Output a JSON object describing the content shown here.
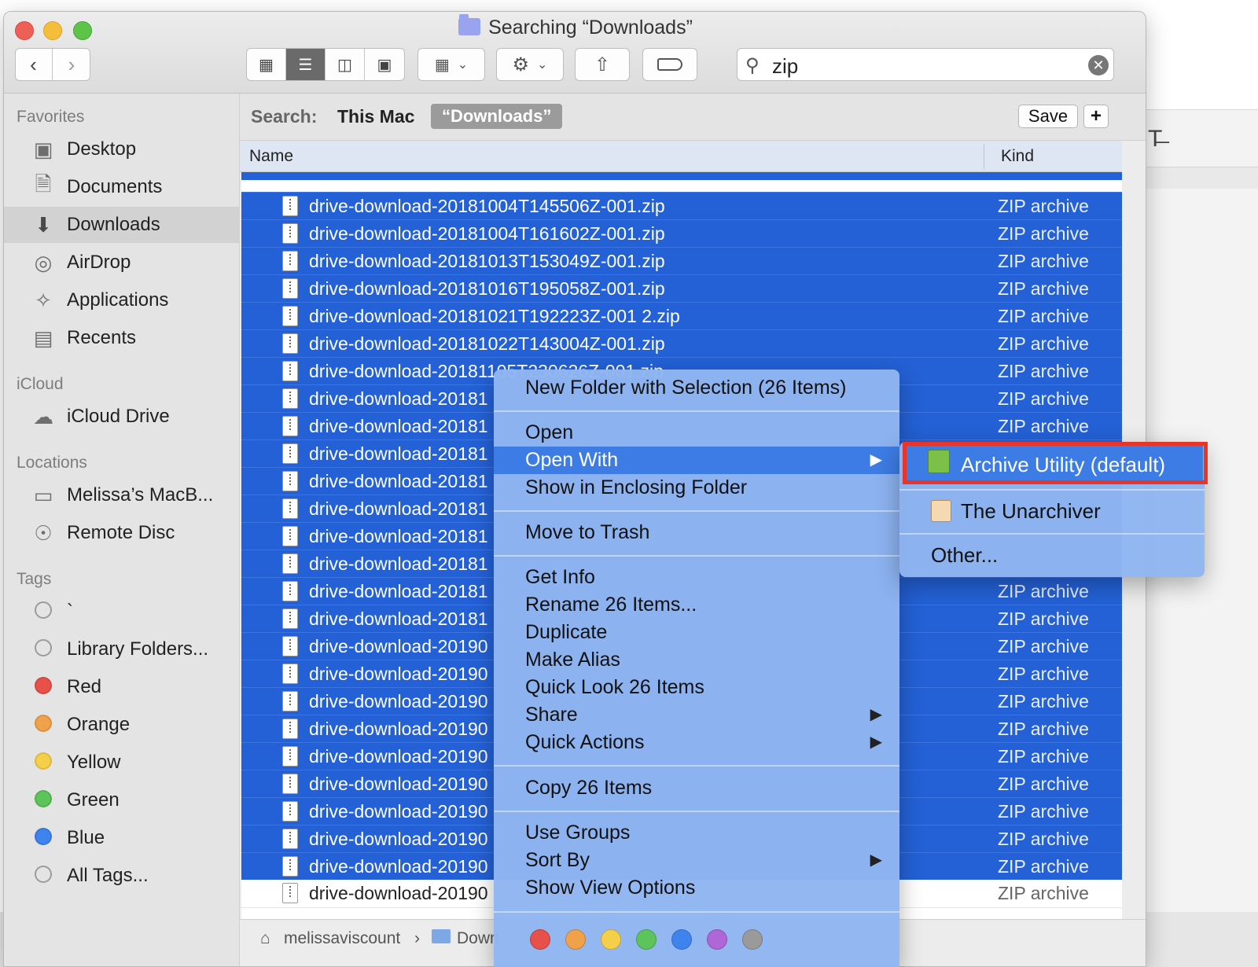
{
  "window": {
    "title": "Searching “Downloads”"
  },
  "toolbar": {
    "search_value": "zip",
    "icons": [
      "icon-view-icon",
      "list-view-icon",
      "column-view-icon",
      "gallery-view-icon",
      "group-icon",
      "gear-icon",
      "share-icon",
      "tag-icon",
      "search-icon",
      "clear-icon"
    ]
  },
  "sidebar": {
    "favorites_label": "Favorites",
    "favorites": [
      "Desktop",
      "Documents",
      "Downloads",
      "AirDrop",
      "Applications",
      "Recents"
    ],
    "icloud_label": "iCloud",
    "icloud": [
      "iCloud Drive"
    ],
    "locations_label": "Locations",
    "locations": [
      "Melissa’s MacB...",
      "Remote Disc"
    ],
    "tags_label": "Tags",
    "tags": [
      {
        "name": "`",
        "color": "#d0d0d0"
      },
      {
        "name": "Library Folders...",
        "color": "#d0d0d0"
      },
      {
        "name": "Red",
        "color": "#e8504a"
      },
      {
        "name": "Orange",
        "color": "#f0a24a"
      },
      {
        "name": "Yellow",
        "color": "#f4cf4a"
      },
      {
        "name": "Green",
        "color": "#5cc45a"
      },
      {
        "name": "Blue",
        "color": "#3f84ee"
      },
      {
        "name": "All Tags...",
        "color": "#d0d0d0"
      }
    ]
  },
  "scope": {
    "label": "Search:",
    "this_mac": "This Mac",
    "downloads": "“Downloads”",
    "save": "Save",
    "plus": "+"
  },
  "columns": {
    "name": "Name",
    "kind": "Kind"
  },
  "files": [
    {
      "name": "drive-download-20181004T145506Z-001.zip",
      "kind": "ZIP archive"
    },
    {
      "name": "drive-download-20181004T161602Z-001.zip",
      "kind": "ZIP archive"
    },
    {
      "name": "drive-download-20181013T153049Z-001.zip",
      "kind": "ZIP archive"
    },
    {
      "name": "drive-download-20181016T195058Z-001.zip",
      "kind": "ZIP archive"
    },
    {
      "name": "drive-download-20181021T192223Z-001 2.zip",
      "kind": "ZIP archive"
    },
    {
      "name": "drive-download-20181022T143004Z-001.zip",
      "kind": "ZIP archive"
    },
    {
      "name": "drive-download-20181105T230626Z-001.zip",
      "kind": "ZIP archive"
    },
    {
      "name": "drive-download-20181",
      "kind": "ZIP archive"
    },
    {
      "name": "drive-download-20181",
      "kind": "ZIP archive"
    },
    {
      "name": "drive-download-20181",
      "kind": "ZIP archive"
    },
    {
      "name": "drive-download-20181",
      "kind": ""
    },
    {
      "name": "drive-download-20181",
      "kind": ""
    },
    {
      "name": "drive-download-20181",
      "kind": ""
    },
    {
      "name": "drive-download-20181",
      "kind": ""
    },
    {
      "name": "drive-download-20181",
      "kind": "ZIP archive"
    },
    {
      "name": "drive-download-20181",
      "kind": "ZIP archive"
    },
    {
      "name": "drive-download-20190",
      "kind": "ZIP archive"
    },
    {
      "name": "drive-download-20190",
      "kind": "ZIP archive"
    },
    {
      "name": "drive-download-20190",
      "kind": "ZIP archive"
    },
    {
      "name": "drive-download-20190",
      "kind": "ZIP archive"
    },
    {
      "name": "drive-download-20190",
      "kind": "ZIP archive"
    },
    {
      "name": "drive-download-20190",
      "kind": "ZIP archive"
    },
    {
      "name": "drive-download-20190",
      "kind": "ZIP archive"
    },
    {
      "name": "drive-download-20190",
      "kind": "ZIP archive"
    },
    {
      "name": "drive-download-20190",
      "kind": "ZIP archive"
    }
  ],
  "unselected_file": {
    "name": "drive-download-20190",
    "kind": "ZIP archive"
  },
  "pathbar": {
    "home": "melissaviscount",
    "sep": "›",
    "folder": "Down"
  },
  "context_menu": {
    "new_folder": "New Folder with Selection (26 Items)",
    "open": "Open",
    "open_with": "Open With",
    "show_enclosing": "Show in Enclosing Folder",
    "move_trash": "Move to Trash",
    "get_info": "Get Info",
    "rename": "Rename 26 Items...",
    "duplicate": "Duplicate",
    "make_alias": "Make Alias",
    "quick_look": "Quick Look 26 Items",
    "share": "Share",
    "quick_actions": "Quick Actions",
    "copy": "Copy 26 Items",
    "use_groups": "Use Groups",
    "sort_by": "Sort By",
    "show_view_options": "Show View Options",
    "tag_colors": [
      "#e8504a",
      "#f0a24a",
      "#f4cf4a",
      "#5cc45a",
      "#3f84ee",
      "#b066d6",
      "#9a9a9a"
    ]
  },
  "submenu": {
    "archive_utility": "Archive Utility (default)",
    "unarchiver": "The Unarchiver",
    "other": "Other..."
  },
  "highlight_color": "#e8352a",
  "selection_color": "#2461d6"
}
